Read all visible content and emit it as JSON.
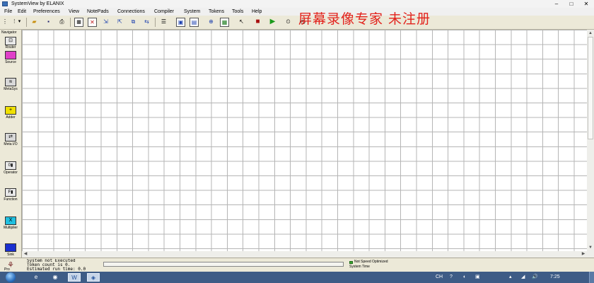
{
  "window": {
    "title": "SystemView by ELANIX"
  },
  "menu": [
    "File",
    "Edit",
    "Preferences",
    "View",
    "NotePads",
    "Connections",
    "Compiler",
    "System",
    "Tokens",
    "Tools",
    "Help"
  ],
  "watermark": "屏幕录像专家 未注册",
  "navigator": {
    "title": "Navigator",
    "items": [
      {
        "label": "Router",
        "icon_text": "⊡"
      },
      {
        "label": "Source",
        "icon_text": "",
        "color": "#e040c8"
      },
      {
        "label": "MetaSys",
        "icon_text": "≋"
      },
      {
        "label": "Adder",
        "icon_text": "+",
        "color": "#f0e000"
      },
      {
        "label": "Meta I/O",
        "icon_text": "⇄"
      },
      {
        "label": "Operator",
        "icon_text": "0▮"
      },
      {
        "label": "Function",
        "icon_text": "F▮"
      },
      {
        "label": "Multiplier",
        "icon_text": "X",
        "color": "#20c0e0"
      },
      {
        "label": "Sink",
        "icon_text": "",
        "color": "#1a2fd0"
      }
    ]
  },
  "status": {
    "icon_label": "Pro",
    "messages": [
      "System not Executed",
      "Token count is 0.",
      "Estimated run time: 0.0"
    ],
    "optimize_label": "Not Speed Optimized",
    "system_time_label": "System Time"
  },
  "taskbar": {
    "tray": [
      "CH",
      "?",
      "◐",
      "▣",
      "▴",
      "◢",
      "🔊"
    ],
    "clock": "7:25"
  }
}
